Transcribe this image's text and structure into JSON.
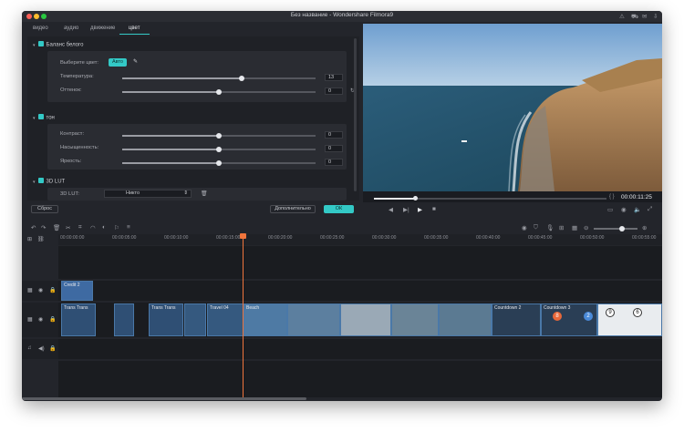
{
  "window": {
    "title": "Без название - Wondershare Filmora9"
  },
  "tabs": [
    "видео",
    "аудио",
    "движение",
    "цвет"
  ],
  "white_balance": {
    "section_label": "Баланс белого",
    "choose_color_label": "Выберите цвет:",
    "auto_button": "Авто",
    "temperature": {
      "label": "Температура:",
      "value": "13",
      "level": 0.62
    },
    "tint": {
      "label": "Оттенок:",
      "value": "0",
      "level": 0.5
    }
  },
  "tone": {
    "section_label": "тон",
    "contrast": {
      "label": "Контраст:",
      "value": "0",
      "level": 0.5
    },
    "saturation": {
      "label": "Насыщенность:",
      "value": "0",
      "level": 0.5
    },
    "brightness": {
      "label": "Яркость:",
      "value": "0",
      "level": 0.5
    }
  },
  "lut": {
    "section_label": "3D LUT",
    "field_label": "3D LUT:",
    "selected": "Никто"
  },
  "footer": {
    "reset_button": "Сброс",
    "advanced_button": "Дополнительно",
    "ok_button": "ОК"
  },
  "player": {
    "timecode": "00:00:11:25",
    "progress": 0.18
  },
  "ruler_labels": [
    "00:00:00:00",
    "00:00:05:00",
    "00:00:10:00",
    "00:00:15:00",
    "00:00:20:00",
    "00:00:25:00",
    "00:00:30:00",
    "00:00:35:00",
    "00:00:40:00",
    "00:00:45:00",
    "00:00:50:00",
    "00:00:55:00",
    "00:00:60:00"
  ],
  "clips": {
    "credit": "Credit 2",
    "trans1": "Trans Trans",
    "trans2": "Trans Trans",
    "travel": "Travel 04",
    "countdown2": "Countdown 2",
    "countdown3": "Countdown 3",
    "beach": "Beach"
  },
  "colors": {
    "accent": "#33c9c6",
    "playhead": "#f0753c",
    "clip_border": "#4a78a8"
  }
}
